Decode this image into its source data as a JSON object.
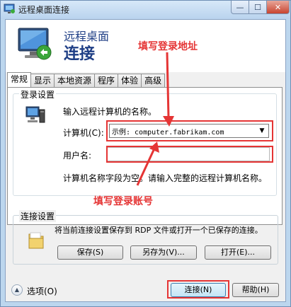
{
  "window": {
    "title": "远程桌面连接",
    "controls": {
      "minimize": "—",
      "maximize": "☐",
      "close": "✕"
    }
  },
  "header": {
    "title": "远程桌面",
    "subtitle": "连接"
  },
  "annotations": {
    "top": "填写登录地址",
    "middle": "填写登录账号",
    "color": "#e53535"
  },
  "tabs": [
    {
      "label": "常规",
      "active": true
    },
    {
      "label": "显示",
      "active": false
    },
    {
      "label": "本地资源",
      "active": false
    },
    {
      "label": "程序",
      "active": false
    },
    {
      "label": "体验",
      "active": false
    },
    {
      "label": "高级",
      "active": false
    }
  ],
  "login_settings": {
    "group_label": "登录设置",
    "prompt": "输入远程计算机的名称。",
    "computer_label": "计算机(C):",
    "computer_placeholder": "示例: computer.fabrikam.com",
    "username_label": "用户名:",
    "username_value": "",
    "status": "计算机名称字段为空。请输入完整的远程计算机名称。"
  },
  "connection_settings": {
    "group_label": "连接设置",
    "description": "将当前连接设置保存到 RDP 文件或打开一个已保存的连接。",
    "save_label": "保存(S)",
    "save_as_label": "另存为(V)...",
    "open_label": "打开(E)..."
  },
  "footer": {
    "options_label": "选项(O)",
    "connect_label": "连接(N)",
    "help_label": "帮助(H)"
  },
  "icons": {
    "title": "remote-desktop-icon",
    "header": "monitor-connection-icon",
    "login": "computer-icon",
    "connection": "folder-icon",
    "options": "chevron-up-icon",
    "dropdown": "chevron-down-icon"
  }
}
